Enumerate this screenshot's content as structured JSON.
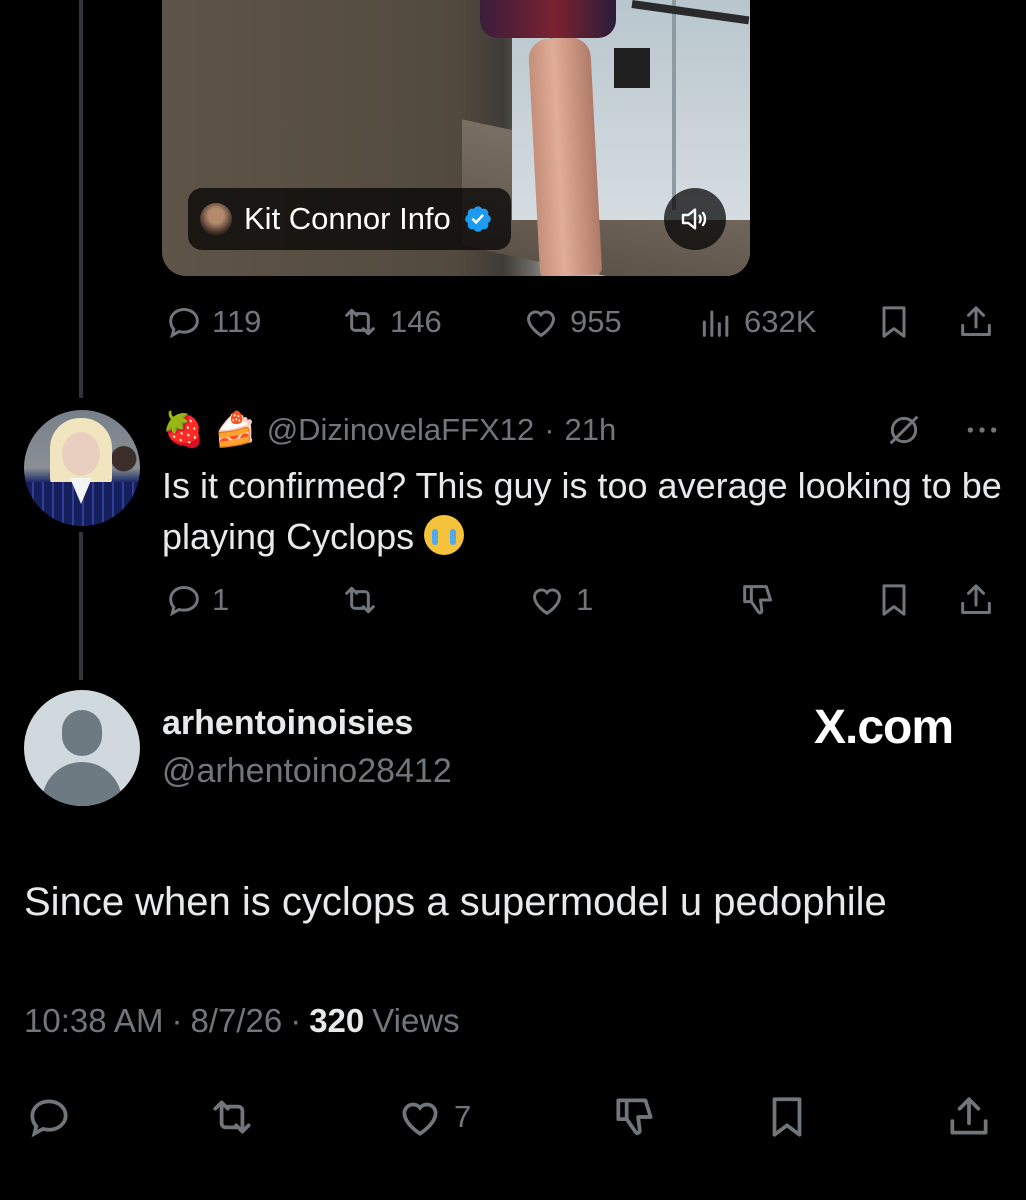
{
  "media": {
    "badge_name": "Kit Connor Info",
    "badge_icon": "verified-badge",
    "sound_icon": "speaker-icon"
  },
  "first_tweet_actions": {
    "replies": "119",
    "reposts": "146",
    "likes": "955",
    "views": "632K"
  },
  "reply": {
    "emoji_1": "🍓",
    "emoji_2": "🍰",
    "handle": "@DizinovelaFFX12",
    "separator": "·",
    "time": "21h",
    "text": "Is it confirmed? This guy is too average looking to be playing Cyclops",
    "reply_count": "1",
    "like_count": "1"
  },
  "main_tweet": {
    "display_name": "arhentoinoisies",
    "handle": "@arhentoino28412",
    "brand": "X.com",
    "text": "Since when is cyclops a supermodel u pedophile",
    "time": "10:38 AM",
    "sep1": "·",
    "date": "8/7/26",
    "sep2": "·",
    "views_count": "320",
    "views_label": "Views",
    "like_count": "7"
  },
  "colors": {
    "background": "#000000",
    "text_primary": "#e7e9ea",
    "text_secondary": "#71767b",
    "verified_blue": "#1d9bf0"
  }
}
